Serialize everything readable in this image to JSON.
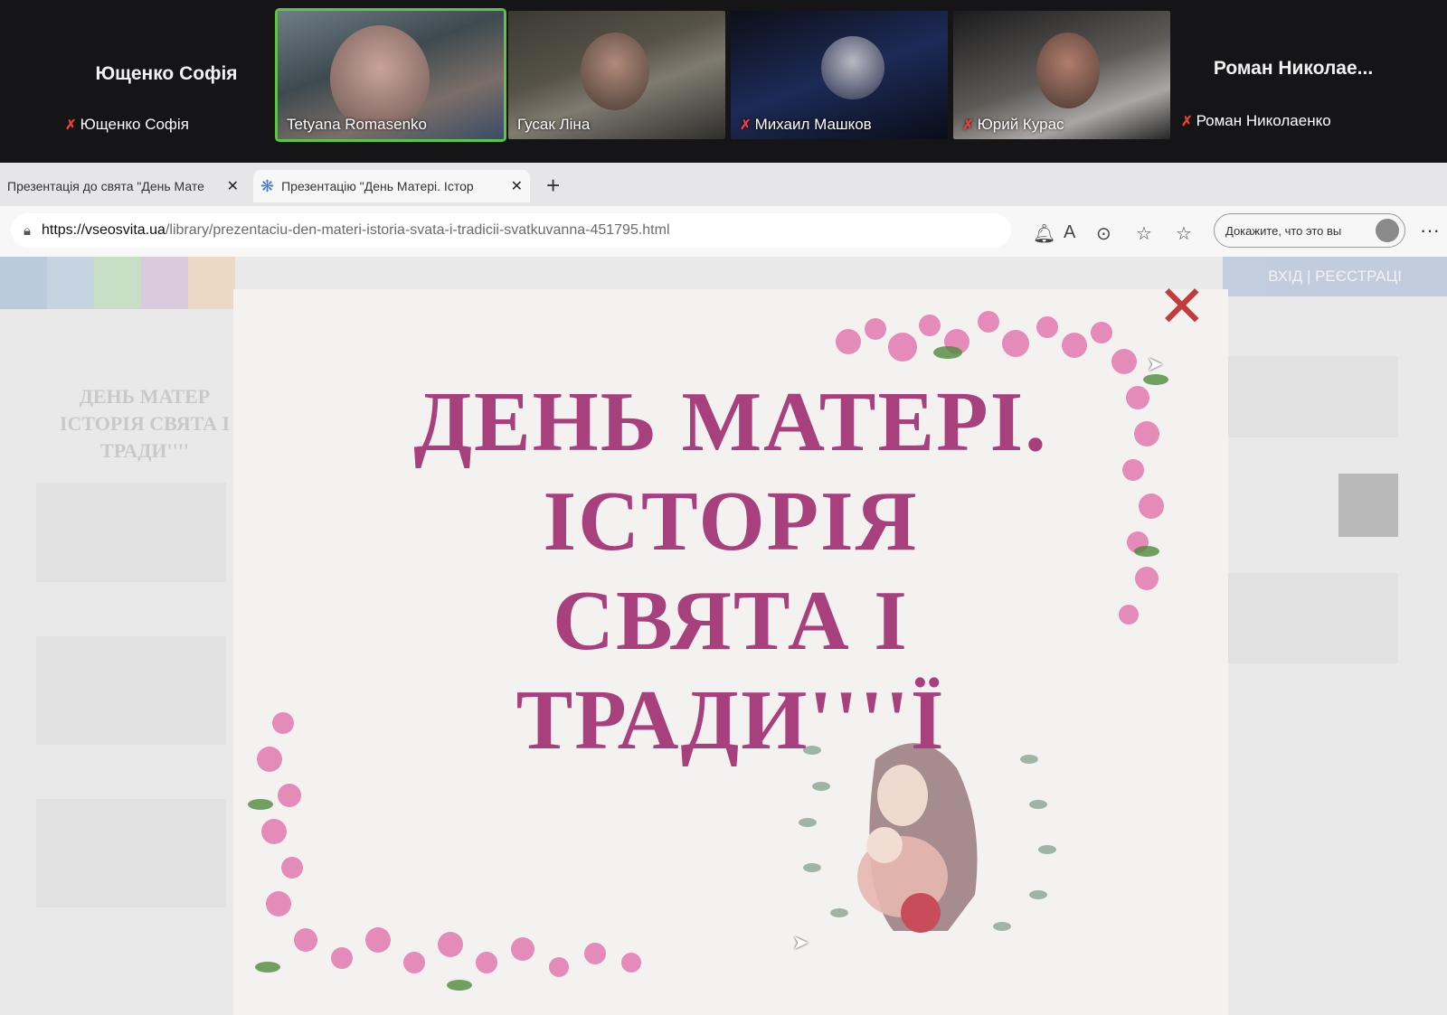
{
  "zoom": {
    "participants": [
      {
        "name": "Ющенко Софія",
        "caption": "Ющенко Софія",
        "video": false,
        "muted": true
      },
      {
        "caption": "Tetyana Romasenko",
        "video": true,
        "muted": false,
        "active": true
      },
      {
        "caption": "Гусак Ліна",
        "video": true,
        "muted": false
      },
      {
        "caption": "Михаил Машков",
        "video": true,
        "muted": true
      },
      {
        "caption": "Юрий Курас",
        "video": true,
        "muted": true
      },
      {
        "name": "Роман  Николае...",
        "caption": "Роман Николаенко",
        "video": false,
        "muted": true
      }
    ]
  },
  "browser": {
    "tabs": [
      {
        "label": "Презентація до свята \"День Мате",
        "active": false
      },
      {
        "label": "Презентацію \"День Матері. Істор",
        "active": true
      }
    ],
    "new_tab": "+",
    "url_host": "https://vseosvita.ua",
    "url_path": "/library/prezentaciu-den-materi-istoria-svata-i-tradicii-svatkuvanna-451795.html",
    "profile_label": "Докажите, что это вы",
    "menu": "···"
  },
  "site": {
    "header_button": "ВХІД | РЕЄСТРАЦІ",
    "bg_title": "ДЕНЬ МАТЕР ІСТОРІЯ СВЯТА І ТРАДИ''''"
  },
  "slide": {
    "title_lines": [
      "ДЕНЬ МАТЕРІ.",
      "ІСТОРІЯ",
      "СВЯТА І",
      "ТРАДИ''''Ї"
    ],
    "accent_color": "#a8407d",
    "close_icon": "close-icon"
  },
  "colors": {
    "muted_mic": "#e8403a",
    "active_speaker": "#5ec34a"
  }
}
